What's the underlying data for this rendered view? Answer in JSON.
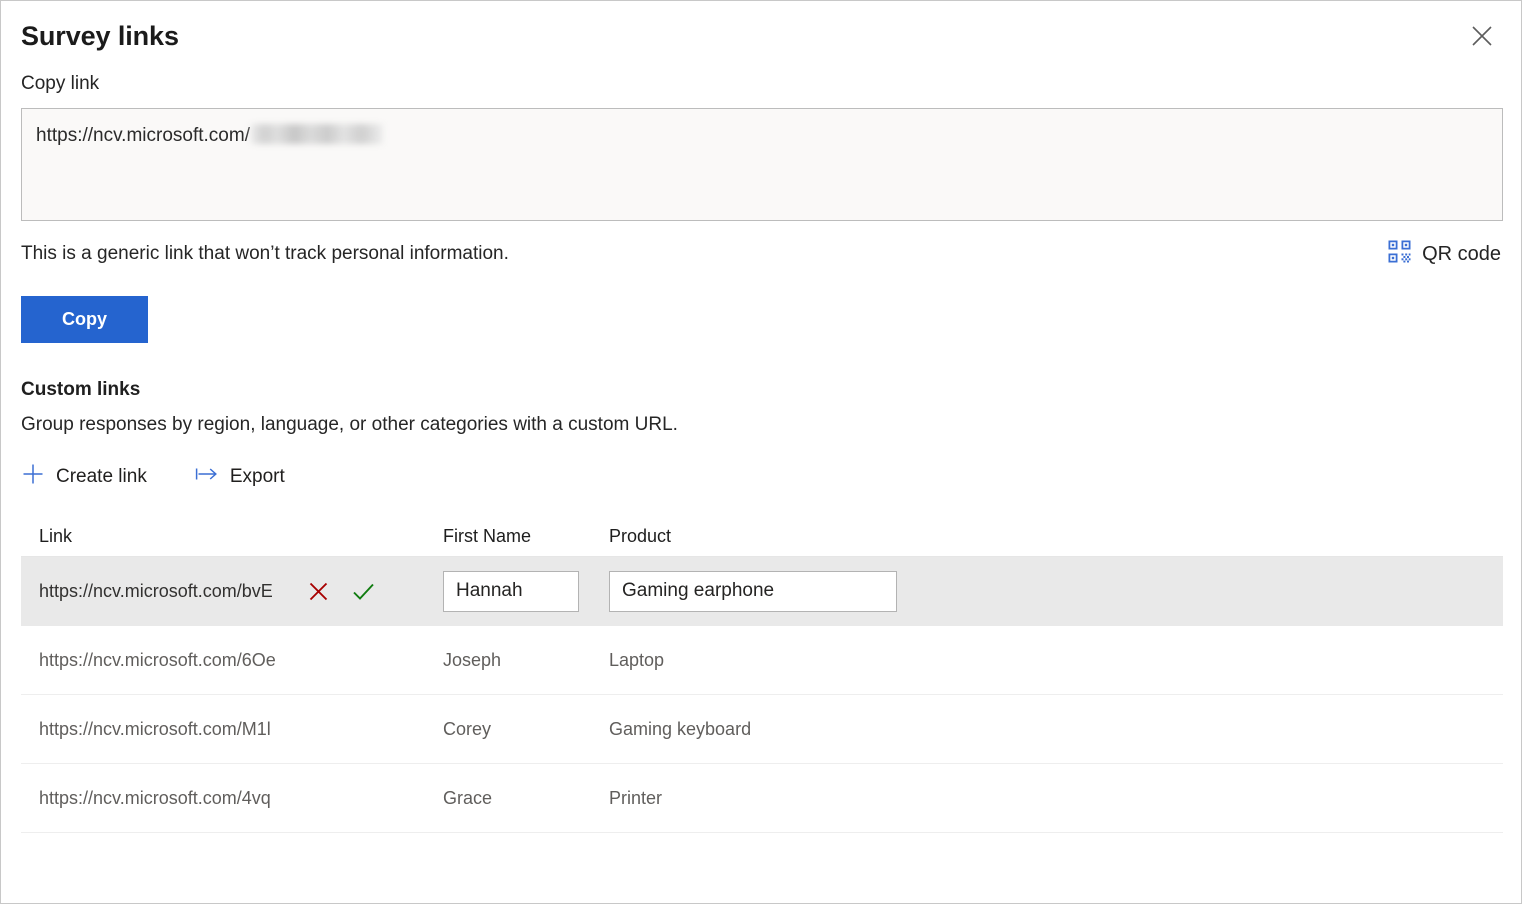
{
  "panel": {
    "title": "Survey links",
    "close_icon": "close-icon"
  },
  "copy_link": {
    "label": "Copy link",
    "url_prefix": "https://ncv.microsoft.com/",
    "url_suffix_redacted": true,
    "note": "This is a generic link that won’t track personal information.",
    "qr_label": "QR code",
    "qr_icon": "qr-code-icon",
    "copy_button": "Copy"
  },
  "custom_links": {
    "title": "Custom links",
    "description": "Group responses by region, language, or other categories with a custom URL.",
    "commands": [
      {
        "label": "Create link",
        "icon": "plus-icon"
      },
      {
        "label": "Export",
        "icon": "export-arrow-icon"
      }
    ],
    "table": {
      "columns": [
        "Link",
        "First Name",
        "Product"
      ],
      "rows": [
        {
          "link": "https://ncv.microsoft.com/bvE",
          "first_name": "Hannah",
          "product": "Gaming earphone",
          "selected": true,
          "editing": true,
          "cancel_icon": "cancel-x-icon",
          "confirm_icon": "confirm-check-icon"
        },
        {
          "link": "https://ncv.microsoft.com/6Oe",
          "first_name": "Joseph",
          "product": "Laptop",
          "selected": false,
          "editing": false
        },
        {
          "link": "https://ncv.microsoft.com/M1l",
          "first_name": "Corey",
          "product": "Gaming keyboard",
          "selected": false,
          "editing": false
        },
        {
          "link": "https://ncv.microsoft.com/4vq",
          "first_name": "Grace",
          "product": "Printer",
          "selected": false,
          "editing": false
        }
      ]
    }
  },
  "colors": {
    "accent_blue": "#2564cf",
    "icon_blue": "#3b6fd4",
    "cancel_red": "#a80000",
    "confirm_green": "#107c10",
    "selected_row": "#e9e9e9"
  }
}
